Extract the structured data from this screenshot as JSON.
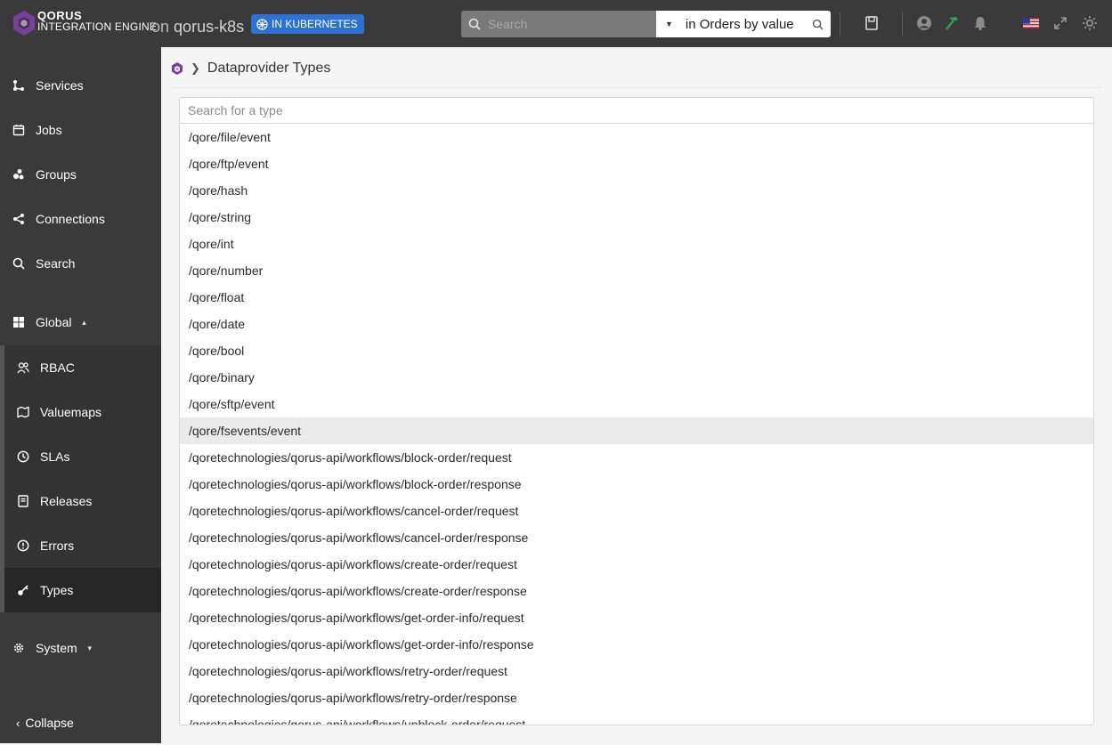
{
  "app": {
    "brand_line1": "QORUS",
    "brand_line2": "INTEGRATION ENGINE",
    "on_label": "on",
    "instance": "qorus-k8s",
    "env_badge": "IN KUBERNETES",
    "accent": "#7a3e9d",
    "badge_color": "#2d72d2"
  },
  "search": {
    "placeholder": "Search",
    "scope": "in Orders by value"
  },
  "toolbar_icons": [
    "save-icon",
    "user-icon",
    "hammer-icon",
    "bell-icon",
    "flag-us-icon",
    "expand-icon",
    "sun-icon"
  ],
  "sidebar": {
    "items": [
      {
        "label": "Services",
        "icon": "services-icon"
      },
      {
        "label": "Jobs",
        "icon": "calendar-icon"
      },
      {
        "label": "Groups",
        "icon": "groups-icon"
      },
      {
        "label": "Connections",
        "icon": "connections-icon"
      },
      {
        "label": "Search",
        "icon": "search-icon"
      }
    ],
    "global": {
      "label": "Global",
      "icon": "dashboard-icon"
    },
    "global_items": [
      {
        "label": "RBAC",
        "icon": "people-icon"
      },
      {
        "label": "Valuemaps",
        "icon": "map-icon"
      },
      {
        "label": "SLAs",
        "icon": "clock-icon"
      },
      {
        "label": "Releases",
        "icon": "book-icon"
      },
      {
        "label": "Errors",
        "icon": "error-icon"
      },
      {
        "label": "Types",
        "icon": "key-icon"
      }
    ],
    "system": {
      "label": "System",
      "icon": "cog-icon"
    },
    "collapse": "Collapse"
  },
  "main": {
    "page_title": "Dataprovider Types",
    "type_search_placeholder": "Search for a type",
    "selected_index": 11,
    "types": [
      "/qore/file/event",
      "/qore/ftp/event",
      "/qore/hash",
      "/qore/string",
      "/qore/int",
      "/qore/number",
      "/qore/float",
      "/qore/date",
      "/qore/bool",
      "/qore/binary",
      "/qore/sftp/event",
      "/qore/fsevents/event",
      "/qoretechnologies/qorus-api/workflows/block-order/request",
      "/qoretechnologies/qorus-api/workflows/block-order/response",
      "/qoretechnologies/qorus-api/workflows/cancel-order/request",
      "/qoretechnologies/qorus-api/workflows/cancel-order/response",
      "/qoretechnologies/qorus-api/workflows/create-order/request",
      "/qoretechnologies/qorus-api/workflows/create-order/response",
      "/qoretechnologies/qorus-api/workflows/get-order-info/request",
      "/qoretechnologies/qorus-api/workflows/get-order-info/response",
      "/qoretechnologies/qorus-api/workflows/retry-order/request",
      "/qoretechnologies/qorus-api/workflows/retry-order/response",
      "/qoretechnologies/qorus-api/workflows/unblock-order/request"
    ]
  }
}
